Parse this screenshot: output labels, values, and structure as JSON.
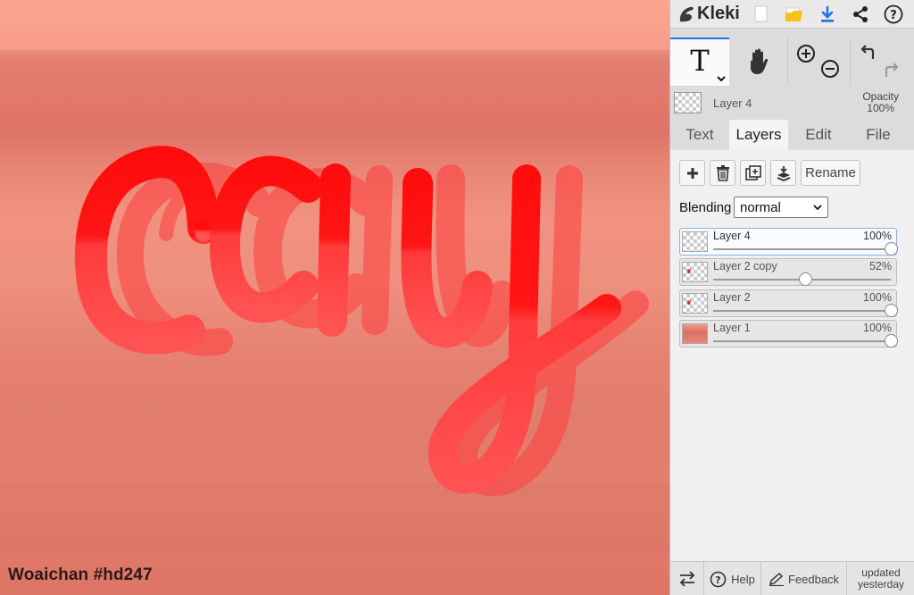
{
  "app": {
    "name": "Kleki"
  },
  "canvas": {
    "signature": "Woaichan #hd247",
    "lettering_color": "#ff1a1a"
  },
  "toolbar": {
    "icons": [
      "new-image-icon",
      "open-folder-icon",
      "download-icon",
      "share-icon",
      "help-icon"
    ],
    "tools": [
      "text-tool-icon",
      "hand-tool-icon",
      "zoom-in-icon",
      "zoom-out-icon",
      "undo-icon",
      "redo-icon"
    ],
    "accent": "#1a73e8"
  },
  "current_layer": {
    "name": "Layer 4",
    "opacity_label": "Opacity",
    "opacity_value": "100%"
  },
  "tabs": [
    {
      "label": "Text",
      "active": false
    },
    {
      "label": "Layers",
      "active": true
    },
    {
      "label": "Edit",
      "active": false
    },
    {
      "label": "File",
      "active": false
    }
  ],
  "layer_actions": {
    "rename_label": "Rename",
    "icons": [
      "add-layer-icon",
      "delete-layer-icon",
      "duplicate-layer-icon",
      "merge-down-icon"
    ]
  },
  "blending": {
    "label": "Blending",
    "value": "normal"
  },
  "layers": [
    {
      "name": "Layer 4",
      "opacity": "100%",
      "opacity_value": 1.0,
      "selected": true
    },
    {
      "name": "Layer 2 copy",
      "opacity": "52%",
      "opacity_value": 0.52,
      "selected": false
    },
    {
      "name": "Layer 2",
      "opacity": "100%",
      "opacity_value": 1.0,
      "selected": false
    },
    {
      "name": "Layer 1",
      "opacity": "100%",
      "opacity_value": 1.0,
      "selected": false
    }
  ],
  "bottom": {
    "help_label": "Help",
    "feedback_label": "Feedback",
    "updated_line1": "updated",
    "updated_line2": "yesterday"
  }
}
